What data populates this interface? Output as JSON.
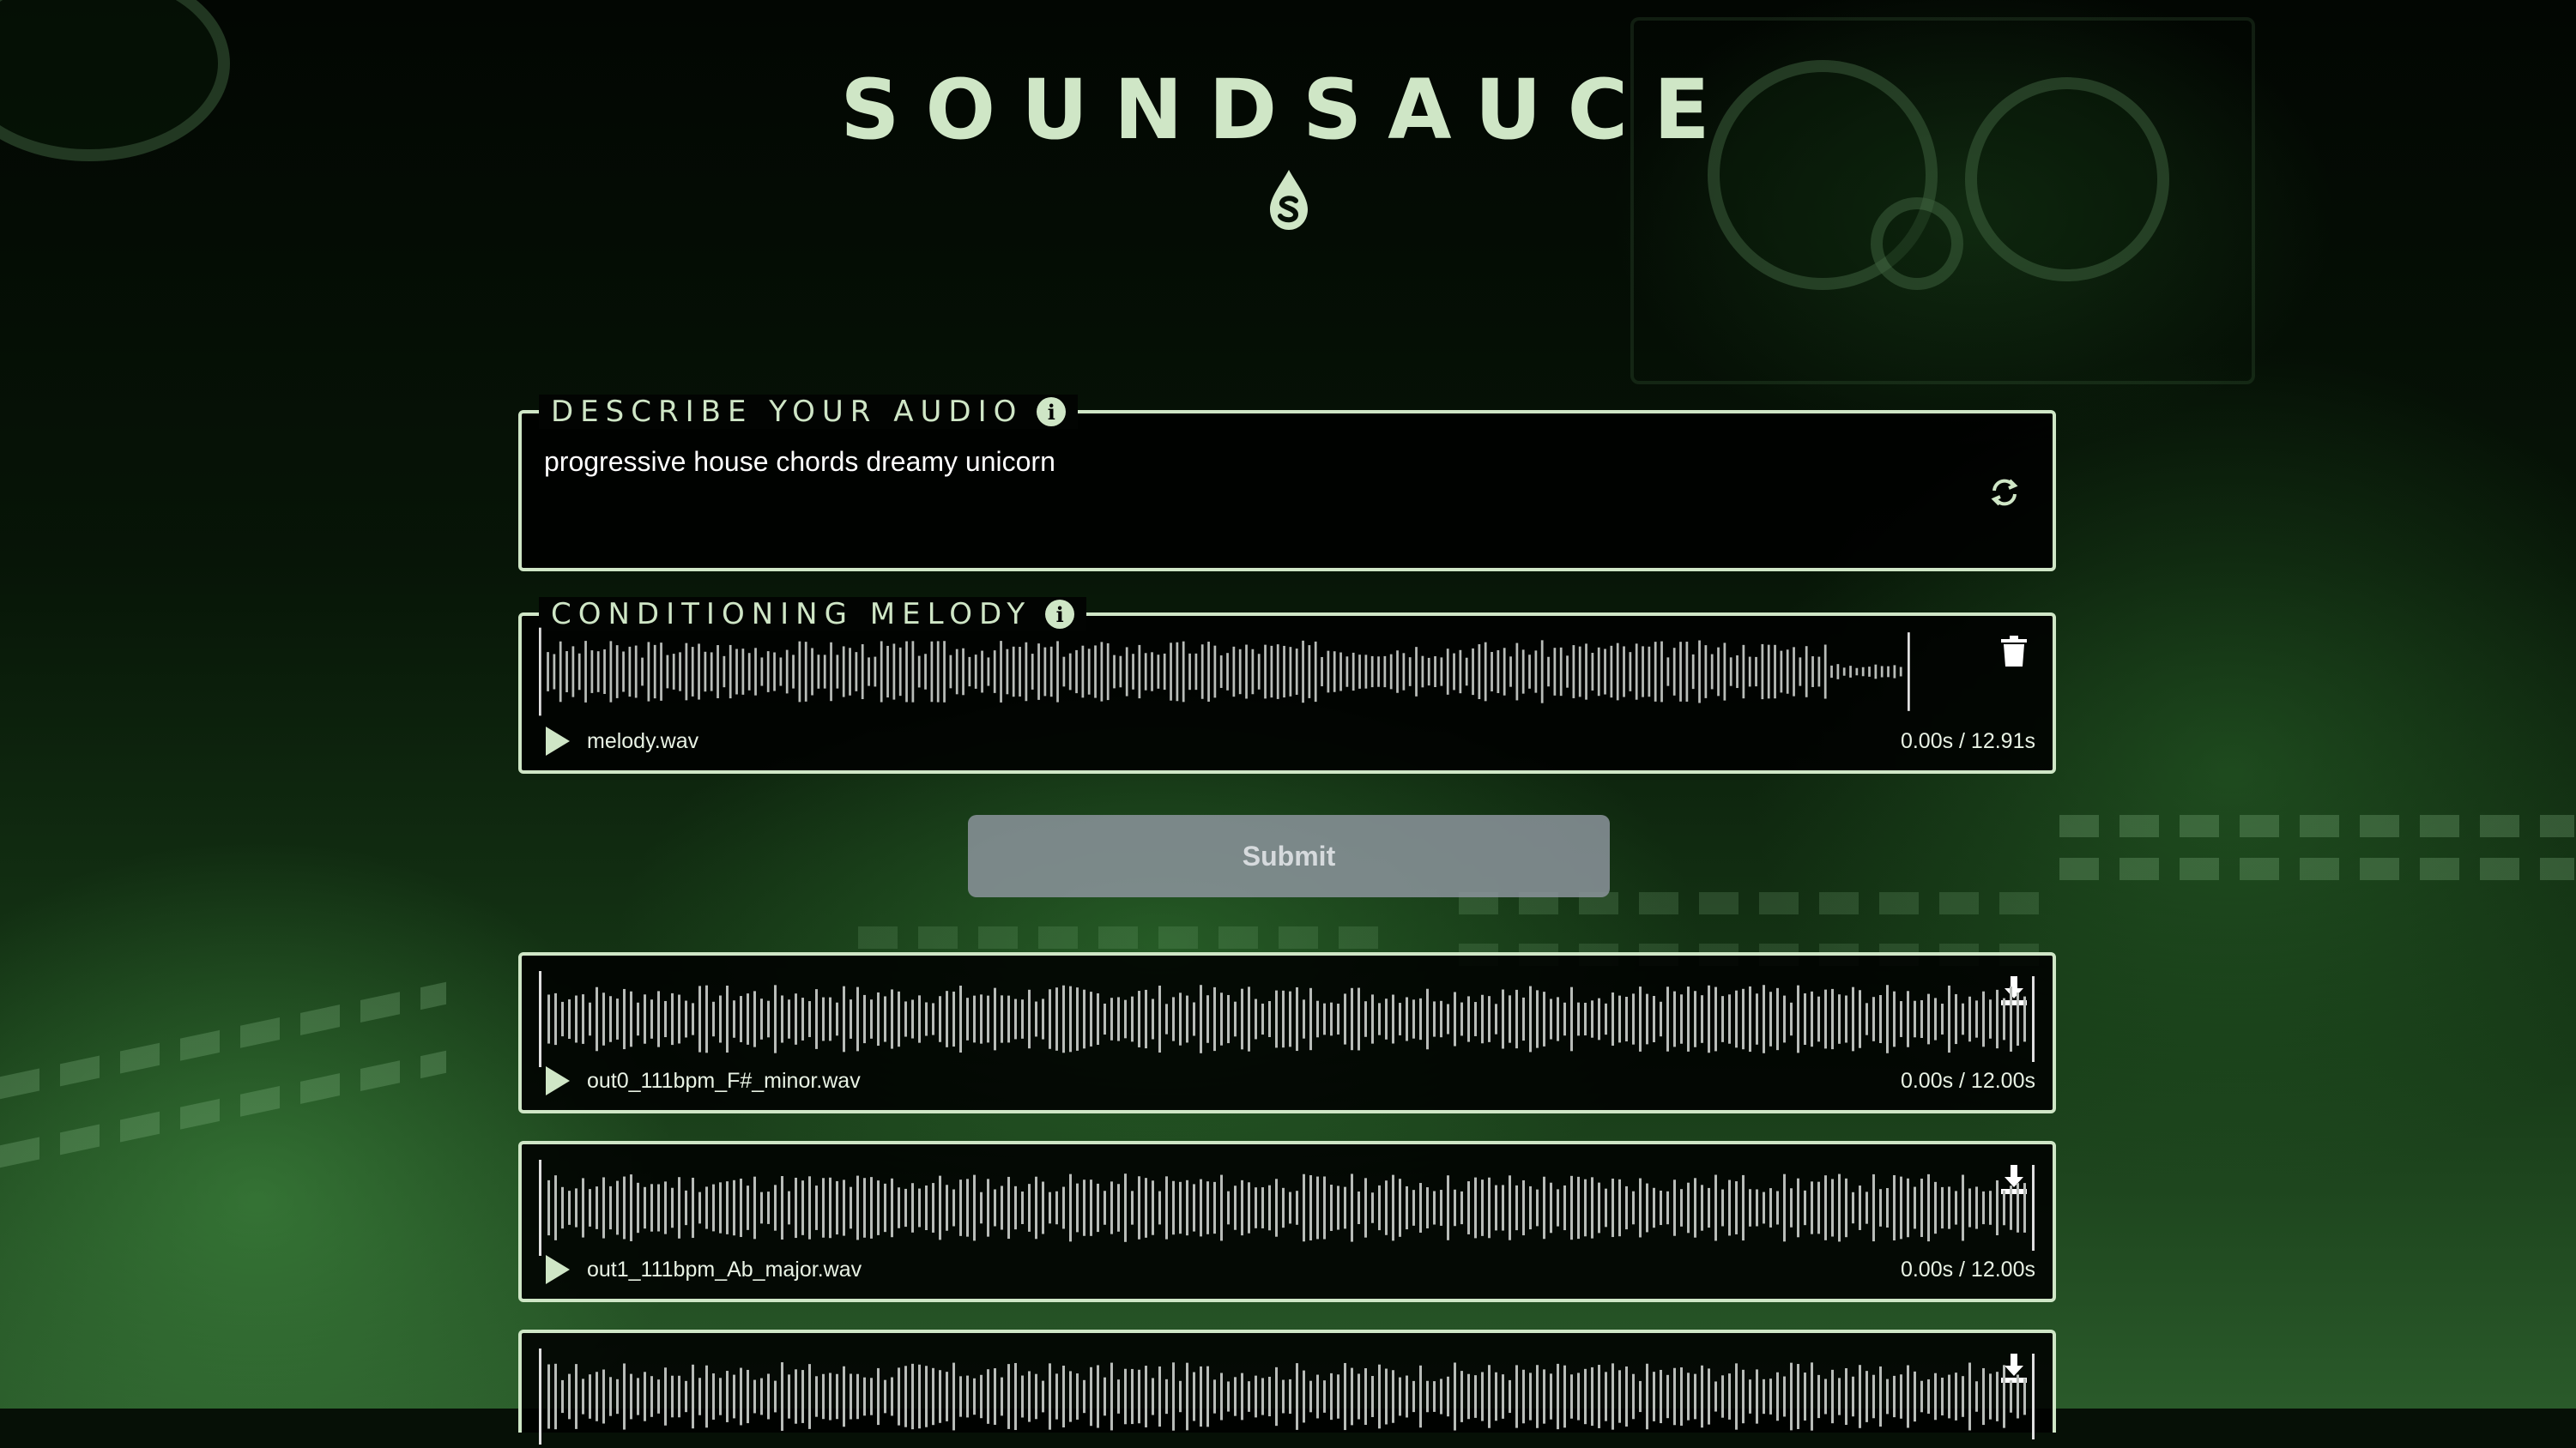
{
  "brand": {
    "title": "SOUNDSAUCE",
    "logo_icon": "sauce-drop-icon"
  },
  "prompt": {
    "label": "DESCRIBE YOUR AUDIO",
    "value": "progressive house chords dreamy unicorn",
    "info_icon": "info-icon",
    "regenerate_icon": "regenerate-icon"
  },
  "melody": {
    "label": "CONDITIONING MELODY",
    "info_icon": "info-icon",
    "file": "melody.wav",
    "time": "0.00s / 12.91s",
    "delete_icon": "trash-icon"
  },
  "submit_label": "Submit",
  "outputs": [
    {
      "file": "out0_111bpm_F#_minor.wav",
      "time": "0.00s / 12.00s",
      "download_icon": "download-icon"
    },
    {
      "file": "out1_111bpm_Ab_major.wav",
      "time": "0.00s / 12.00s",
      "download_icon": "download-icon"
    },
    {
      "download_icon": "download-icon"
    }
  ],
  "colors": {
    "accent": "#cfe6c6",
    "panel": "#000000",
    "button": "#8c949c"
  }
}
